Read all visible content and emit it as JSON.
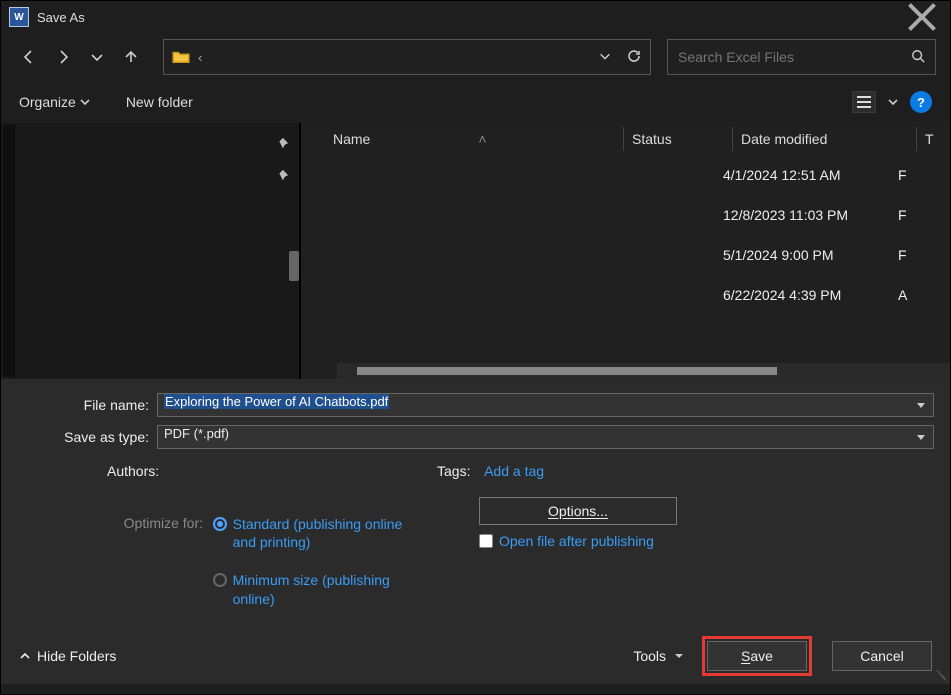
{
  "titlebar": {
    "title": "Save As"
  },
  "nav": {},
  "addressbar": {
    "path": "‹"
  },
  "search": {
    "placeholder": "Search Excel Files"
  },
  "toolbar": {
    "organize": "Organize",
    "new_folder": "New folder"
  },
  "columns": {
    "name": "Name",
    "status": "Status",
    "date_modified": "Date modified",
    "type_initial": "T"
  },
  "files": [
    {
      "name": "",
      "status": "",
      "date": "4/1/2024 12:51 AM",
      "type_initial": "F"
    },
    {
      "name": "",
      "status": "",
      "date": "12/8/2023 11:03 PM",
      "type_initial": "F"
    },
    {
      "name": "",
      "status": "",
      "date": "5/1/2024 9:00 PM",
      "type_initial": "F"
    },
    {
      "name": "",
      "status": "",
      "date": "6/22/2024 4:39 PM",
      "type_initial": "A"
    }
  ],
  "form": {
    "file_name_label": "File name:",
    "file_name_value": "Exploring the Power of AI Chatbots.pdf",
    "save_as_type_label": "Save as type:",
    "save_as_type_value": "PDF (*.pdf)",
    "authors_label": "Authors:",
    "tags_label": "Tags:",
    "add_tag": "Add a tag",
    "optimize_label": "Optimize for:",
    "optimize_standard": "Standard (publishing online and printing)",
    "optimize_minimum": "Minimum size (publishing online)",
    "options_button": "Options...",
    "open_after": "Open file after publishing"
  },
  "bottom": {
    "hide_folders": "Hide Folders",
    "tools": "Tools",
    "save": "Save",
    "cancel": "Cancel"
  }
}
